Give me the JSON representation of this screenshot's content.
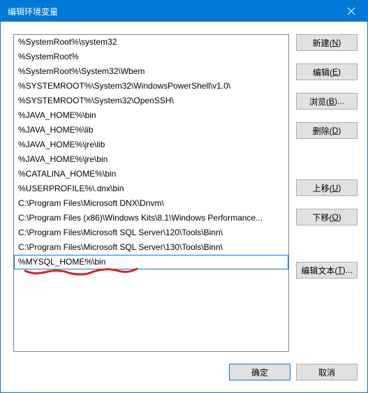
{
  "window": {
    "title": "编辑环境变量"
  },
  "list": {
    "items": [
      "%SystemRoot%\\system32",
      "%SystemRoot%",
      "%SystemRoot%\\System32\\Wbem",
      "%SYSTEMROOT%\\System32\\WindowsPowerShell\\v1.0\\",
      "%SYSTEMROOT%\\System32\\OpenSSH\\",
      "%JAVA_HOME%\\bin",
      "%JAVA_HOME%\\lib",
      "%JAVA_HOME%\\jre\\lib",
      "%JAVA_HOME%\\jre\\bin",
      "%CATALINA_HOME%\\bin",
      "%USERPROFILE%\\.dnx\\bin",
      "C:\\Program Files\\Microsoft DNX\\Dnvm\\",
      "C:\\Program Files (x86)\\Windows Kits\\8.1\\Windows Performance...",
      "C:\\Program Files\\Microsoft SQL Server\\120\\Tools\\Binn\\",
      "C:\\Program Files\\Microsoft SQL Server\\130\\Tools\\Binn\\",
      "%MYSQL_HOME%\\bin"
    ],
    "selected_index": 15
  },
  "buttons": {
    "new": {
      "label": "新建(",
      "accel": "N",
      "suffix": ")"
    },
    "edit": {
      "label": "编辑(",
      "accel": "E",
      "suffix": ")"
    },
    "browse": {
      "label": "浏览(",
      "accel": "B",
      "suffix": ")..."
    },
    "delete": {
      "label": "删除(",
      "accel": "D",
      "suffix": ")"
    },
    "moveup": {
      "label": "上移(",
      "accel": "U",
      "suffix": ")"
    },
    "movedown": {
      "label": "下移(",
      "accel": "O",
      "suffix": ")"
    },
    "edittext": {
      "label": "编辑文本(",
      "accel": "T",
      "suffix": ")..."
    }
  },
  "footer": {
    "ok": "确定",
    "cancel": "取消"
  },
  "annotation_color": "#e02020"
}
